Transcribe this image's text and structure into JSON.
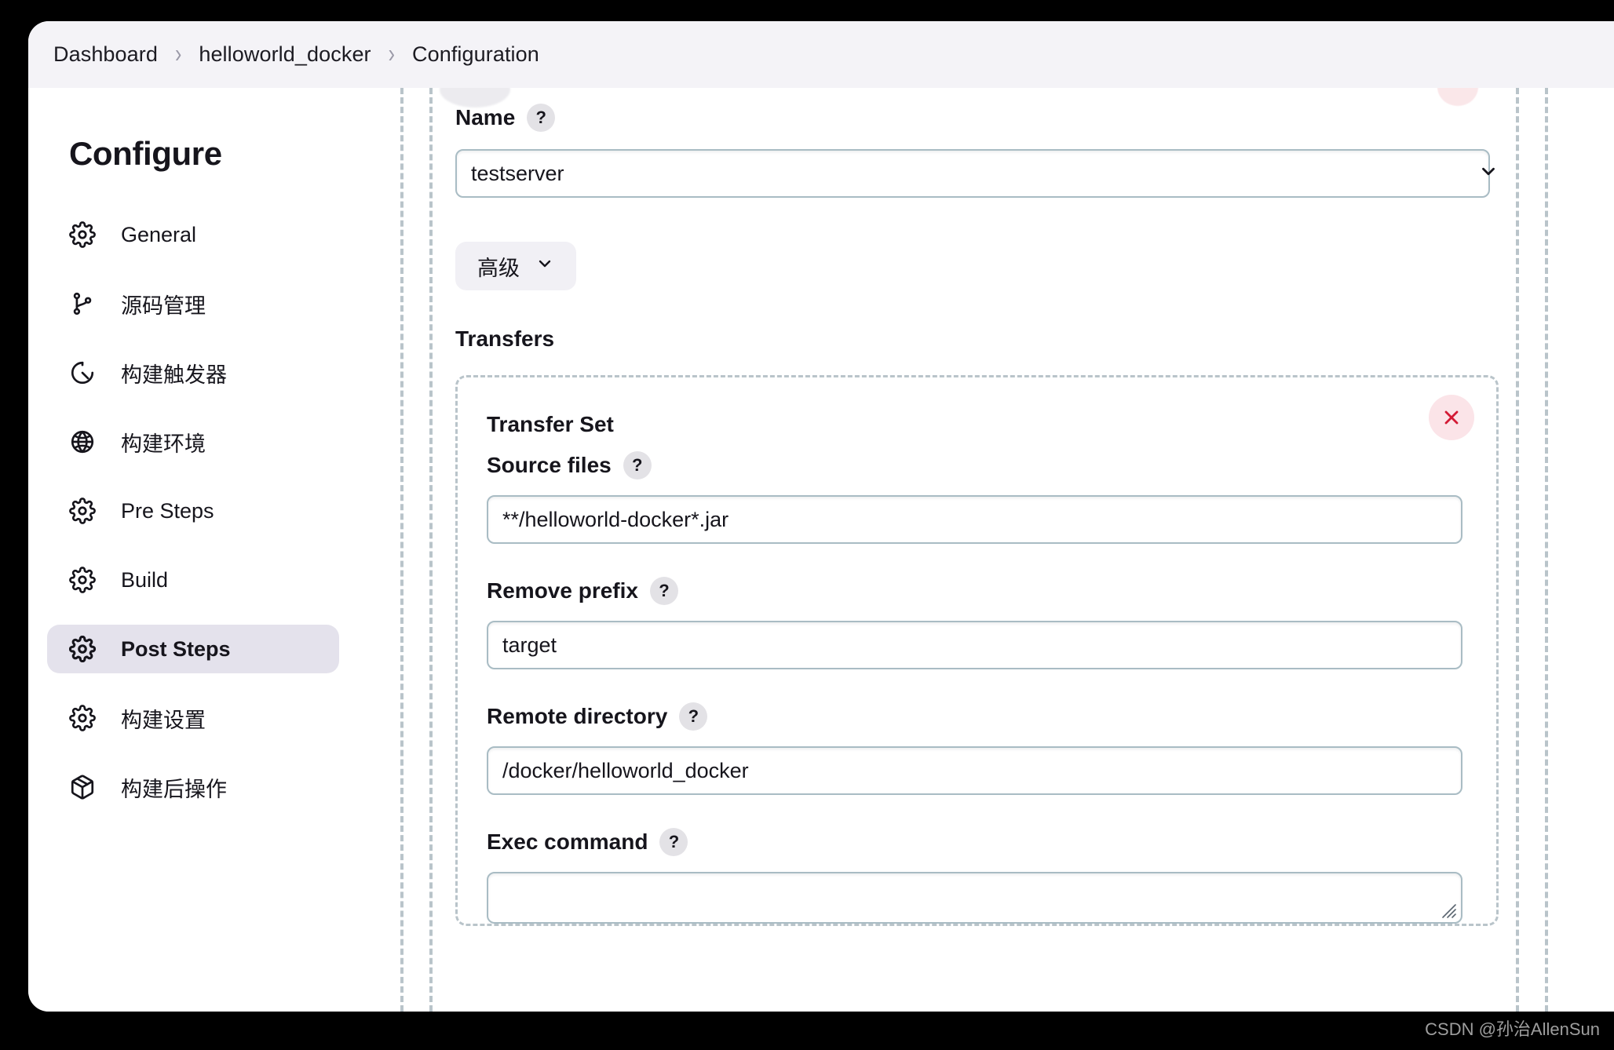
{
  "breadcrumb": {
    "items": [
      {
        "label": "Dashboard"
      },
      {
        "label": "helloworld_docker"
      },
      {
        "label": "Configuration"
      }
    ],
    "separator": "›"
  },
  "sidebar": {
    "title": "Configure",
    "items": [
      {
        "label": "General",
        "icon": "gear-icon",
        "active": false
      },
      {
        "label": "源码管理",
        "icon": "git-branch-icon",
        "active": false
      },
      {
        "label": "构建触发器",
        "icon": "clock-icon",
        "active": false
      },
      {
        "label": "构建环境",
        "icon": "globe-icon",
        "active": false
      },
      {
        "label": "Pre Steps",
        "icon": "gear-icon",
        "active": false
      },
      {
        "label": "Build",
        "icon": "gear-icon",
        "active": false
      },
      {
        "label": "Post Steps",
        "icon": "gear-icon",
        "active": true
      },
      {
        "label": "构建设置",
        "icon": "gear-icon",
        "active": false
      },
      {
        "label": "构建后操作",
        "icon": "package-icon",
        "active": false
      }
    ]
  },
  "main": {
    "name_field": {
      "label": "Name",
      "help": "?",
      "value": "testserver"
    },
    "advanced_button": {
      "label": "高级",
      "chevron": "chevron-down-icon"
    },
    "transfers_heading": "Transfers",
    "transfer_set": {
      "title": "Transfer Set",
      "close_icon": "close-icon",
      "fields": [
        {
          "label": "Source files",
          "help": "?",
          "value": "**/helloworld-docker*.jar",
          "type": "input"
        },
        {
          "label": "Remove prefix",
          "help": "?",
          "value": "target",
          "type": "input"
        },
        {
          "label": "Remote directory",
          "help": "?",
          "value": "/docker/helloworld_docker",
          "type": "input"
        },
        {
          "label": "Exec command",
          "help": "?",
          "value": "",
          "type": "textarea"
        }
      ]
    }
  },
  "watermark": "CSDN @孙治AllenSun",
  "colors": {
    "header_bg": "#f4f3f7",
    "active_nav_bg": "#e4e2ec",
    "guide_dash": "#b9c4ca",
    "input_border": "#a9bcc4",
    "close_bg": "#fbe4e8",
    "close_mark": "#d31a35",
    "pill_bg": "#f1f0f5",
    "help_bg": "#e3e2e6",
    "text": "#16151c",
    "page_bg": "#000000"
  }
}
